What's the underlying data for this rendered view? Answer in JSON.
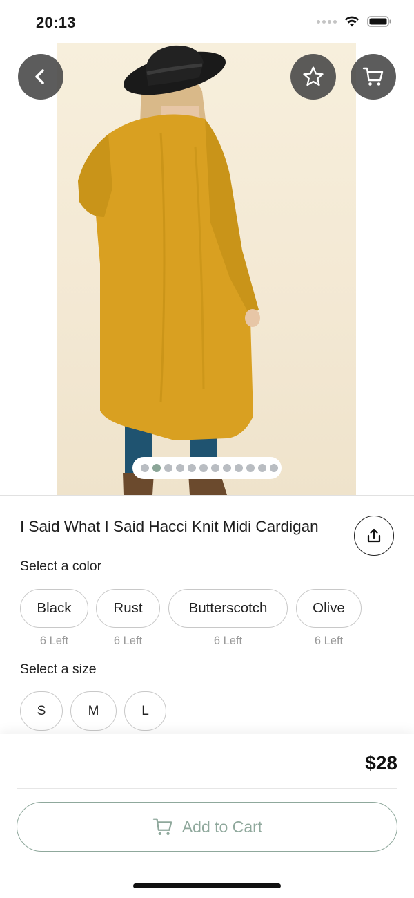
{
  "status_bar": {
    "time": "20:13"
  },
  "product": {
    "title": "I Said What I Said Hacci Knit Midi Cardigan",
    "image_count": 12,
    "active_image_index": 1
  },
  "colors": {
    "label": "Select a color",
    "options": [
      {
        "name": "Black",
        "stock": "6 Left"
      },
      {
        "name": "Rust",
        "stock": "6 Left"
      },
      {
        "name": "Butterscotch",
        "stock": "6 Left"
      },
      {
        "name": "Olive",
        "stock": "6 Left"
      }
    ]
  },
  "sizes": {
    "label": "Select a size",
    "options": [
      "S",
      "M",
      "L"
    ]
  },
  "footer": {
    "price": "$28",
    "add_to_cart_label": "Add to Cart"
  },
  "icons": {
    "back": "chevron-left-icon",
    "favorite": "star-icon",
    "cart": "cart-icon",
    "share": "share-icon"
  },
  "theme": {
    "accent": "#8fa89c",
    "overlay_button": "#464646"
  }
}
